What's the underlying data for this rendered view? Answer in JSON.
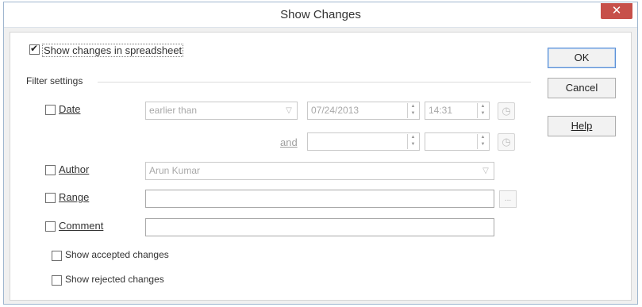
{
  "window": {
    "title": "Show Changes",
    "close_glyph": "✕"
  },
  "show_changes": {
    "label": "Show changes in spreadsheet",
    "checked": true
  },
  "filter": {
    "header": "Filter settings",
    "date": {
      "label": "Date",
      "checked": false,
      "condition": "earlier than",
      "start_date": "07/24/2013",
      "start_time": "14:31",
      "and_label": "and",
      "end_date": "",
      "end_time": ""
    },
    "author": {
      "label": "Author",
      "checked": false,
      "value": "Arun Kumar"
    },
    "range": {
      "label": "Range",
      "checked": false,
      "value": "",
      "browse": "..."
    },
    "comment": {
      "label": "Comment",
      "checked": false,
      "value": ""
    },
    "show_accepted": {
      "label": "Show accepted changes",
      "checked": false
    },
    "show_rejected": {
      "label": "Show rejected changes",
      "checked": false
    }
  },
  "buttons": {
    "ok": "OK",
    "cancel": "Cancel",
    "help": "Help"
  },
  "icons": {
    "dropdown": "chevron-down-icon",
    "spin": "spin-updown-icon",
    "clock": "clock-icon",
    "close": "close-icon"
  },
  "colors": {
    "close_bg": "#c7504a",
    "default_button_border": "#5a8fd6"
  }
}
